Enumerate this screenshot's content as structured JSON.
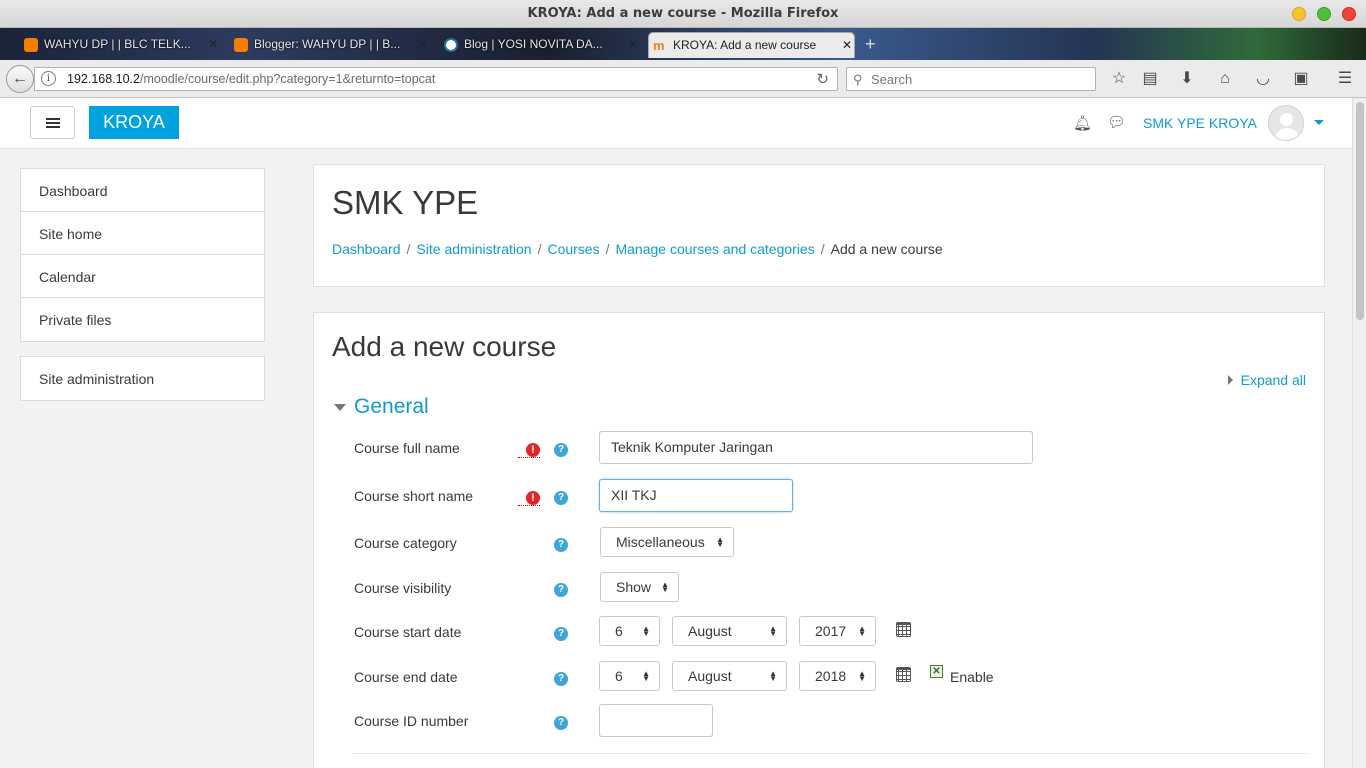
{
  "window": {
    "title": "KROYA: Add a new course - Mozilla Firefox"
  },
  "tabs": [
    {
      "label": "WAHYU DP | | BLC TELK...",
      "icon": "blogger-icon"
    },
    {
      "label": "Blogger: WAHYU DP | | B...",
      "icon": "blogger-icon"
    },
    {
      "label": "Blog | YOSI NOVITA DA...",
      "icon": "wordpress-icon"
    },
    {
      "label": "KROYA: Add a new course",
      "icon": "moodle-icon",
      "active": true
    }
  ],
  "browser": {
    "url_host": "192.168.10.2",
    "url_path": "/moodle/course/edit.php?category=1&returnto=topcat",
    "search_placeholder": "Search"
  },
  "header": {
    "brand": "KROYA",
    "user_name": "SMK YPE KROYA"
  },
  "sidebar": {
    "items": [
      {
        "label": "Dashboard"
      },
      {
        "label": "Site home"
      },
      {
        "label": "Calendar"
      },
      {
        "label": "Private files"
      }
    ],
    "admin": {
      "label": "Site administration"
    }
  },
  "page": {
    "heading": "SMK YPE",
    "breadcrumbs": [
      {
        "label": "Dashboard"
      },
      {
        "label": "Site administration"
      },
      {
        "label": "Courses"
      },
      {
        "label": "Manage courses and categories"
      }
    ],
    "breadcrumb_current": "Add a new course"
  },
  "form": {
    "title": "Add a new course",
    "expand_all": "Expand all",
    "section": "General",
    "full_name": {
      "label": "Course full name",
      "value": "Teknik Komputer Jaringan"
    },
    "short_name": {
      "label": "Course short name",
      "value": "XII TKJ"
    },
    "category": {
      "label": "Course category",
      "value": "Miscellaneous"
    },
    "visibility": {
      "label": "Course visibility",
      "value": "Show"
    },
    "start_date": {
      "label": "Course start date",
      "day": "6",
      "month": "August",
      "year": "2017"
    },
    "end_date": {
      "label": "Course end date",
      "day": "6",
      "month": "August",
      "year": "2018",
      "enable_label": "Enable",
      "enabled": true
    },
    "id_number": {
      "label": "Course ID number",
      "value": ""
    }
  },
  "colors": {
    "brand": "#00a3e0",
    "link": "#0f9ccc",
    "required": "#e0282b",
    "help": "#3fa5d6"
  }
}
